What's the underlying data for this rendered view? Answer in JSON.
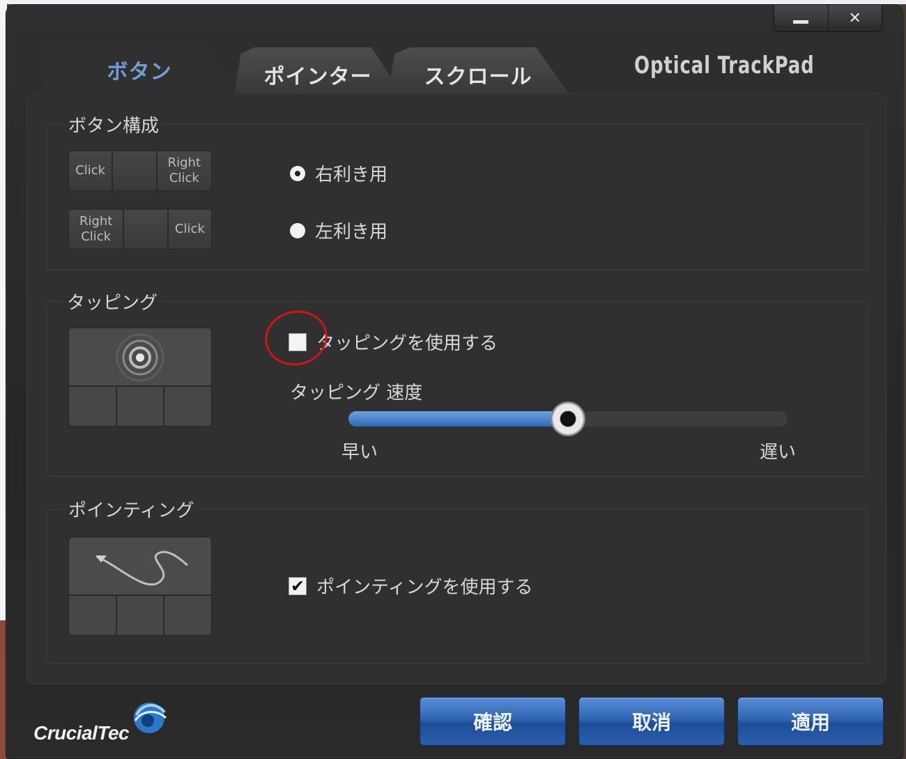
{
  "window": {
    "app_title": "Optical TrackPad",
    "minimize_label": "",
    "close_label": "✕"
  },
  "tabs": [
    {
      "label": "ボタン",
      "active": true
    },
    {
      "label": "ポインター",
      "active": false
    },
    {
      "label": "スクロール",
      "active": false
    }
  ],
  "button_config": {
    "title": "ボタン構成",
    "right_hand_pad": [
      "Click",
      "",
      "Right Click"
    ],
    "left_hand_pad": [
      "Right Click",
      "",
      "Click"
    ],
    "right_hand_label": "右利き用",
    "left_hand_label": "左利き用",
    "selected": "right"
  },
  "tapping": {
    "title": "タッピング",
    "enable_label": "タッピングを使用する",
    "enabled": false,
    "speed_label": "タッピング 速度",
    "speed_min_label": "早い",
    "speed_max_label": "遅い",
    "speed_value_percent": 50
  },
  "pointing": {
    "title": "ポインティング",
    "enable_label": "ポインティングを使用する",
    "enabled": true
  },
  "footer": {
    "brand": "CrucialTec",
    "ok_label": "確認",
    "cancel_label": "取消",
    "apply_label": "適用"
  },
  "colors": {
    "accent_blue": "#2f65b3",
    "active_tab_text": "#6f9fd8",
    "annotation_red": "#d21414"
  }
}
